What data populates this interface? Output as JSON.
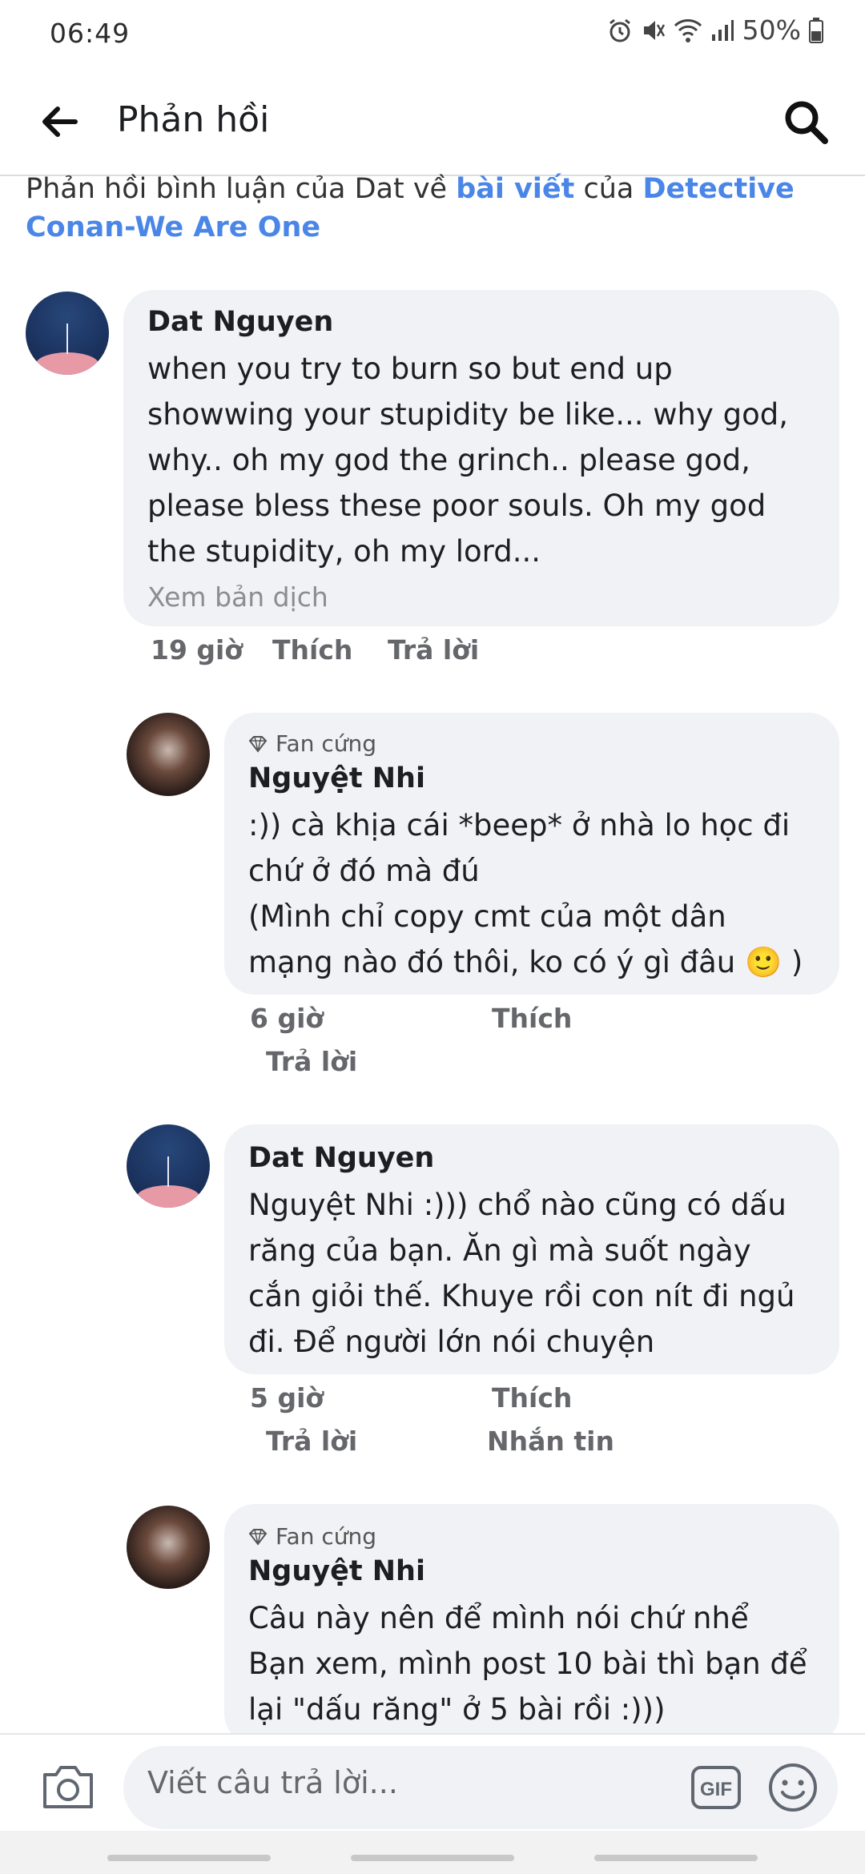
{
  "status": {
    "time": "06:49",
    "battery": "50%"
  },
  "header": {
    "title": "Phản hồi"
  },
  "context": {
    "prefix": "Phản hồi bình luận của Dat về ",
    "link1": "bài viết",
    "middle": " của ",
    "link2": "Detective Conan-We Are One"
  },
  "comments": [
    {
      "author": "Dat Nguyen",
      "text": "when you try to burn so but end up\nshowwing your stupidity be like... why god,\nwhy.. oh my god the grinch.. please god,\nplease bless these poor souls. Oh my god\nthe stupidity, oh my lord...",
      "translate": "Xem bản dịch",
      "time": "19 giờ",
      "like": "Thích",
      "reply": "Trả lời"
    },
    {
      "badge": "Fan cứng",
      "author": "Nguyệt Nhi",
      "text": ":)) cà khịa cái *beep* ở nhà lo học đi\nchứ ở đó mà đú\n(Mình chỉ copy cmt của một dân\nmạng nào đó thôi, ko có ý gì đâu 🙂 )",
      "time": "6 giờ",
      "like": "Thích",
      "reply": "Trả lời"
    },
    {
      "author": "Dat Nguyen",
      "text": "Nguyệt Nhi :))) chổ nào cũng có dấu\nrăng của bạn. Ăn gì mà suốt ngày\ncắn giỏi thế. Khuye rồi con nít đi ngủ\nđi. Để người lớn nói chuyện",
      "time": "5 giờ",
      "like": "Thích",
      "reply": "Trả lời",
      "message": "Nhắn tin"
    },
    {
      "badge": "Fan cứng",
      "author": "Nguyệt Nhi",
      "text": "Câu này nên để mình nói chứ nhể\nBạn xem, mình post 10 bài thì bạn để\nlại \"dấu răng\" ở 5 bài rồi :)))"
    }
  ],
  "composer": {
    "placeholder": "Viết câu trả lời...",
    "gif": "GIF"
  },
  "icons": [
    "alarm-icon",
    "mute-icon",
    "wifi-icon",
    "signal-icon",
    "battery-icon",
    "back-arrow-icon",
    "search-icon",
    "diamond-icon",
    "camera-icon",
    "gif-icon",
    "emoji-icon"
  ],
  "colors": {
    "link": "#4a86e8",
    "bubble": "#f0f2f5"
  }
}
